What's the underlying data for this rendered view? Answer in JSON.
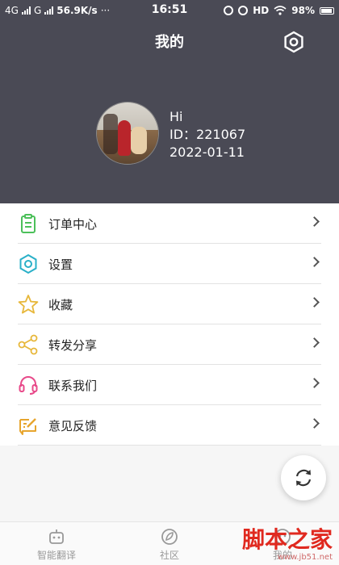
{
  "status_bar": {
    "network_left": "4G",
    "network_right": "G",
    "speed": "56.9K/s",
    "more": "···",
    "time": "16:51",
    "hd": "HD",
    "battery": "98%"
  },
  "header": {
    "title": "我的",
    "settings_icon": "settings-gear-icon",
    "background_color": "#4a4a55"
  },
  "profile": {
    "greeting": "Hi",
    "id_line": "ID：221067",
    "date": "2022-01-11"
  },
  "menu": {
    "items": [
      {
        "label": "订单中心",
        "icon": "clipboard-icon",
        "color": "#4cc05a"
      },
      {
        "label": "设置",
        "icon": "gear-icon",
        "color": "#2ab0c8"
      },
      {
        "label": "收藏",
        "icon": "star-icon",
        "color": "#e7b73a"
      },
      {
        "label": "转发分享",
        "icon": "share-icon",
        "color": "#e7b73a"
      },
      {
        "label": "联系我们",
        "icon": "headset-icon",
        "color": "#e84a8a"
      },
      {
        "label": "意见反馈",
        "icon": "edit-icon",
        "color": "#e7a52e"
      }
    ]
  },
  "floating_button": {
    "icon": "refresh-icon"
  },
  "tabbar": {
    "tabs": [
      {
        "label": "智能翻译",
        "icon": "robot-icon"
      },
      {
        "label": "社区",
        "icon": "leaf-icon"
      },
      {
        "label": "我的",
        "icon": "user-icon"
      }
    ]
  },
  "watermark": {
    "main": "脚本之家",
    "url": "www.jb51.net"
  }
}
